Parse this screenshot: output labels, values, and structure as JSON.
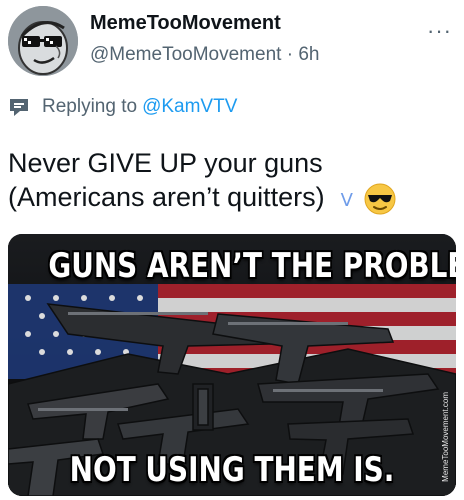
{
  "author": {
    "display_name": "MemeTooMovement",
    "handle": "@MemeTooMovement",
    "separator": " · ",
    "time": "6h",
    "avatar_icon": "sunglasses-cartoon-face"
  },
  "more_label": "···",
  "reply": {
    "prefix": "Replying to",
    "target": "@KamVTV",
    "icon": "reply-context-icon"
  },
  "tweet": {
    "line1": "Never GIVE UP your guns",
    "line2": "(Americans aren’t quitters)",
    "glyph": "V",
    "emoji_icon": "smiling-face-with-sunglasses-emoji"
  },
  "meme": {
    "top_text": "GUNS AREN’T THE PROBLEM.",
    "bottom_text": "NOT USING THEM IS.",
    "watermark": "MemeTooMovement.com",
    "image_icon": "gun-pile-american-flag-image"
  },
  "colors": {
    "link": "#1d9bf0",
    "secondary_text": "#536471",
    "primary_text": "#0f1419"
  }
}
